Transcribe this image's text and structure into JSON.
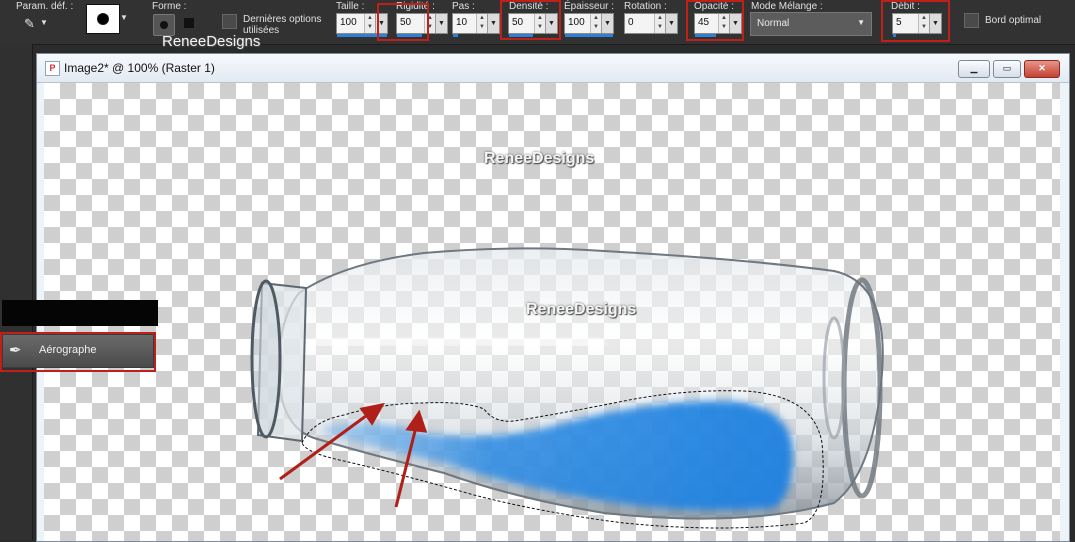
{
  "toolbar": {
    "preset_label": "Param. déf. :",
    "shape_label": "Forme :",
    "last_used_label": "Dernières options utilisées",
    "watermark": "ReneeDesigns",
    "size_label": "Taille :",
    "size_value": "100",
    "hardness_label": "Rigidité :",
    "hardness_value": "50",
    "step_label": "Pas :",
    "step_value": "10",
    "density_label": "Densité :",
    "density_value": "50",
    "thickness_label": "Épaisseur :",
    "thickness_value": "100",
    "rotation_label": "Rotation :",
    "rotation_value": "0",
    "opacity_label": "Opacité :",
    "opacity_value": "45",
    "blend_label": "Mode Mélange :",
    "blend_value": "Normal",
    "rate_label": "Débit :",
    "rate_value": "5",
    "optimal_edge_label": "Bord optimal"
  },
  "document": {
    "title": "Image2* @ 100% (Raster 1)",
    "watermark_top": "ReneeDesigns",
    "watermark_mid": "ReneeDesigns"
  },
  "tool_popup": {
    "tool_name": "Aérographe"
  },
  "colors": {
    "highlight_red": "#c0201a",
    "liquid_blue": "#1a7fe0",
    "accent_bar": "#2f7fd4"
  }
}
